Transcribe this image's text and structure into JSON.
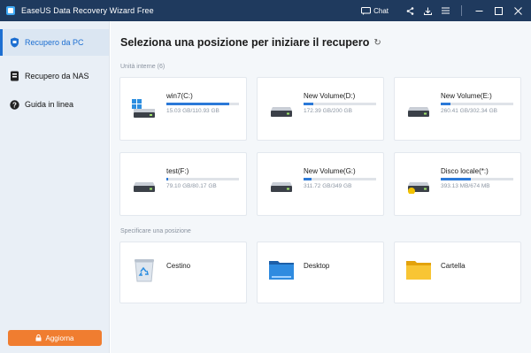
{
  "app": {
    "title": "EaseUS Data Recovery Wizard Free"
  },
  "titlebar": {
    "chat_label": "Chat"
  },
  "colors": {
    "titlebar": "#1f3a5e",
    "accent": "#1d6fd1",
    "upgrade": "#f07d30",
    "sidebar": "#e9eff6"
  },
  "sidebar": {
    "items": [
      {
        "label": "Recupero da PC",
        "icon": "shield-icon"
      },
      {
        "label": "Recupero da NAS",
        "icon": "nas-icon"
      },
      {
        "label": "Guida in linea",
        "icon": "help-icon"
      }
    ],
    "upgrade_label": "Aggiorna"
  },
  "main": {
    "title": "Seleziona una posizione per iniziare il recupero",
    "internal_label": "Unità interne (6)",
    "location_label": "Specificare una posizione",
    "drives": [
      {
        "name": "win7(C:)",
        "size": "15.03 GB/110.93 GB",
        "used": 0.86,
        "icon": "windows-drive-icon"
      },
      {
        "name": "New Volume(D:)",
        "size": "172.39 GB/200 GB",
        "used": 0.14,
        "icon": "drive-icon"
      },
      {
        "name": "New Volume(E:)",
        "size": "260.41 GB/302.34 GB",
        "used": 0.14,
        "icon": "drive-icon"
      },
      {
        "name": "test(F:)",
        "size": "79.10 GB/80.17 GB",
        "used": 0.02,
        "icon": "drive-icon"
      },
      {
        "name": "New Volume(G:)",
        "size": "311.72 GB/349 GB",
        "used": 0.11,
        "icon": "drive-icon"
      },
      {
        "name": "Disco locale(*:)",
        "size": "393.13 MB/674 MB",
        "used": 0.42,
        "icon": "locked-drive-icon"
      }
    ],
    "locations": [
      {
        "name": "Cestino",
        "icon": "recycle-bin-icon"
      },
      {
        "name": "Desktop",
        "icon": "desktop-folder-icon"
      },
      {
        "name": "Cartella",
        "icon": "folder-icon"
      }
    ]
  }
}
